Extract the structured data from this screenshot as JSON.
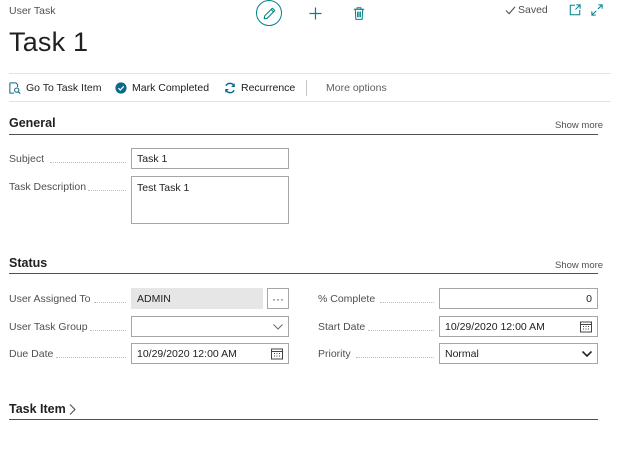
{
  "header": {
    "caption": "User Task",
    "saved": "Saved",
    "title": "Task 1"
  },
  "actions": {
    "go_to_task_item": "Go To Task Item",
    "mark_completed": "Mark Completed",
    "recurrence": "Recurrence",
    "more_options": "More options"
  },
  "general": {
    "title": "General",
    "show_more": "Show more",
    "subject_label": "Subject",
    "subject_value": "Task 1",
    "description_label": "Task Description",
    "description_value": "Test Task 1"
  },
  "status": {
    "title": "Status",
    "show_more": "Show more",
    "assigned_label": "User Assigned To",
    "assigned_value": "ADMIN",
    "lookup": "···",
    "group_label": "User Task Group",
    "group_value": "",
    "due_label": "Due Date",
    "due_value": "10/29/2020 12:00 AM",
    "complete_label": "% Complete",
    "complete_value": "0",
    "start_label": "Start Date",
    "start_value": "10/29/2020 12:00 AM",
    "priority_label": "Priority",
    "priority_value": "Normal"
  },
  "task_item": {
    "title": "Task Item"
  },
  "colors": {
    "accent": "#00838a",
    "action_icon": "#0b6a8a"
  }
}
